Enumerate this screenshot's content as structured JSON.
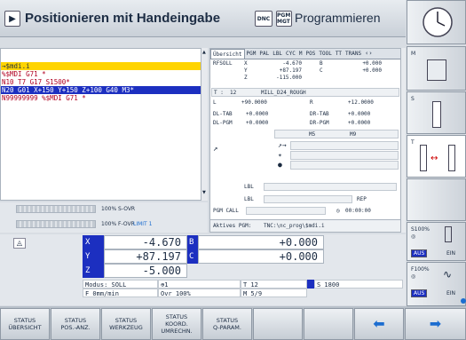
{
  "header": {
    "title": "Positionieren mit Handeingabe",
    "mode_dnc": "DNC",
    "mode_pgm": "PGM MGT",
    "mode_title": "Programmieren"
  },
  "program": {
    "lines": [
      "→$mdi.i",
      "%$MDI G71 *",
      "N10 T7 G17 S1500*",
      "N20 G01 X+150 Y+150 Z+100 G40 M3*",
      "N99999999 %$MDI G71 *"
    ]
  },
  "overrides": {
    "s_label": "100% S-OVR",
    "f_label": "100% F-OVR",
    "limit_label": "LIMIT 1"
  },
  "status": {
    "tabs": [
      "Übersicht",
      "PGM",
      "PAL",
      "LBL",
      "CYC",
      "M",
      "POS",
      "TOOL",
      "TT",
      "TRANS"
    ],
    "rfsoll": "RFSOLL",
    "rows": [
      {
        "a": "X",
        "av": "-4.670",
        "b": "B",
        "bv": "+0.000"
      },
      {
        "a": "Y",
        "av": "+87.197",
        "b": "C",
        "bv": "+0.000"
      },
      {
        "a": "Z",
        "av": "-115.000",
        "b": "",
        "bv": ""
      }
    ],
    "tool_t": "T :",
    "tool_no": "12",
    "tool_name": "MILL_D24_ROUGH",
    "l_label": "L",
    "l_val": "+90.0000",
    "r_label": "R",
    "r_val": "+12.0000",
    "dl_tab": "DL-TAB",
    "dl_tab_val": "+0.0000",
    "dr_tab": "DR-TAB",
    "dr_tab_val": "+0.0000",
    "dl_pgm": "DL-PGM",
    "dl_pgm_val": "+0.0000",
    "dr_pgm": "DR-PGM",
    "dr_pgm_val": "+0.0000",
    "m5": "M5",
    "m9": "M9",
    "lbl1": "LBL",
    "lbl2": "LBL",
    "rep": "REP",
    "pgm_call": "PGM CALL",
    "time": "00:00:00",
    "active_pgm_label": "Aktives PGM:",
    "active_pgm": "TNC:\\nc_prog\\$mdi.i"
  },
  "axes": {
    "rows": [
      {
        "l1": "X",
        "v1": "-4.670",
        "l2": "B",
        "v2": "+0.000"
      },
      {
        "l1": "Y",
        "v1": "+87.197",
        "l2": "C",
        "v2": "+0.000"
      },
      {
        "l1": "Z",
        "v1": "-5.000",
        "l2": "",
        "v2": ""
      }
    ],
    "modus": "Modus: SOLL",
    "feed": "F 0mm/min",
    "ovr": "Ovr 100%",
    "tool": "T 12",
    "spindle": "S 1800",
    "m": "M 5/9"
  },
  "softkeys": [
    {
      "line1": "STATUS",
      "line2": "ÜBERSICHT"
    },
    {
      "line1": "STATUS",
      "line2": "POS.-ANZ."
    },
    {
      "line1": "STATUS",
      "line2": "WERKZEUG"
    },
    {
      "line1": "STATUS",
      "line2": "KOORD. UMRECHN."
    },
    {
      "line1": "STATUS",
      "line2": "Q-PARAM."
    }
  ],
  "side": {
    "m_label": "M",
    "s_label": "S",
    "t_label": "T",
    "s100": "S100%",
    "f100": "F100%",
    "aus": "AUS",
    "ein": "EIN",
    "aus2": "AUS",
    "ein2": "EIN"
  }
}
